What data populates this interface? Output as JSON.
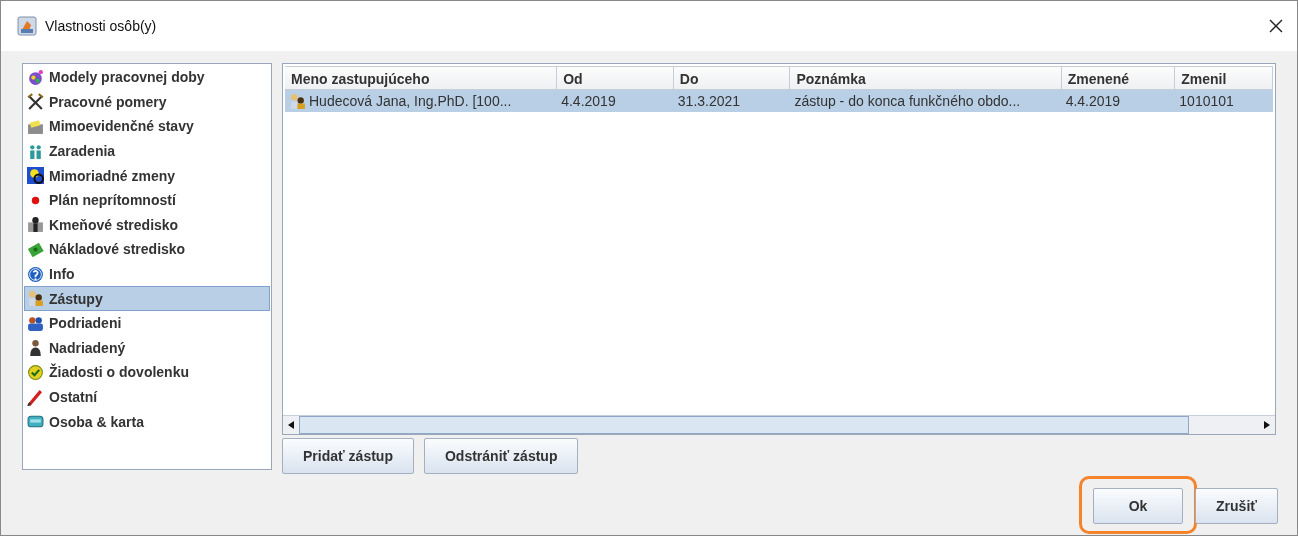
{
  "window": {
    "title": "Vlastnosti osôb(y)"
  },
  "sidebar": {
    "items": [
      {
        "label": "Modely pracovnej doby",
        "selected": false
      },
      {
        "label": "Pracovné pomery",
        "selected": false
      },
      {
        "label": "Mimoevidenčné stavy",
        "selected": false
      },
      {
        "label": "Zaradenia",
        "selected": false
      },
      {
        "label": "Mimoriadné zmeny",
        "selected": false
      },
      {
        "label": "Plán neprítomností",
        "selected": false
      },
      {
        "label": "Kmeňové stredisko",
        "selected": false
      },
      {
        "label": "Nákladové stredisko",
        "selected": false
      },
      {
        "label": "Info",
        "selected": false
      },
      {
        "label": "Zástupy",
        "selected": true
      },
      {
        "label": "Podriadeni",
        "selected": false
      },
      {
        "label": "Nadriadený",
        "selected": false
      },
      {
        "label": "Žiadosti o dovolenku",
        "selected": false
      },
      {
        "label": "Ostatní",
        "selected": false
      },
      {
        "label": "Osoba & karta",
        "selected": false
      }
    ]
  },
  "table": {
    "columns": [
      "Meno zastupujúceho",
      "Od",
      "Do",
      "Poznámka",
      "Zmenené",
      "Zmenil"
    ],
    "rows": [
      {
        "selected": true,
        "cells": [
          "Hudecová Jana, Ing.PhD. [100...",
          "4.4.2019",
          "31.3.2021",
          "zástup - do konca funkčného obdo...",
          "4.4.2019",
          "1010101"
        ]
      }
    ]
  },
  "table_buttons": [
    "Pridať zástup",
    "Odstrániť zástup"
  ],
  "dialog_buttons": [
    {
      "label": "Ok",
      "highlighted": true
    },
    {
      "label": "Zrušiť",
      "highlighted": false
    }
  ]
}
